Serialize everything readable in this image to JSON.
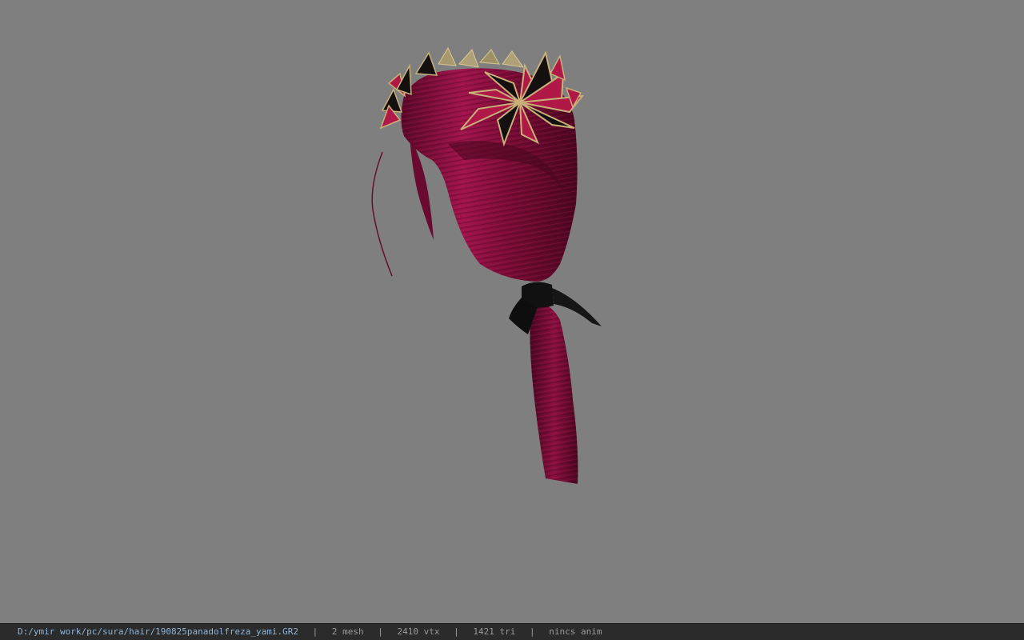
{
  "viewer": {
    "background_color": "#7f7f7f",
    "model_subject": "hair-model"
  },
  "status_bar": {
    "file_path": "D:/ymir work/pc/sura/hair/190825panadolfreza_yami.GR2",
    "separator": "|",
    "mesh_count": "2 mesh",
    "vertex_count": "2410 vtx",
    "triangle_count": "1421 tri",
    "animation": "nincs anim"
  },
  "colors": {
    "hair": "#8a1040",
    "hair_highlight": "#c02062",
    "hair_shadow": "#4a0620",
    "ribbon": "#111111",
    "gold": "#c8b078",
    "petal_red": "#b01848",
    "petal_black": "#141010"
  }
}
